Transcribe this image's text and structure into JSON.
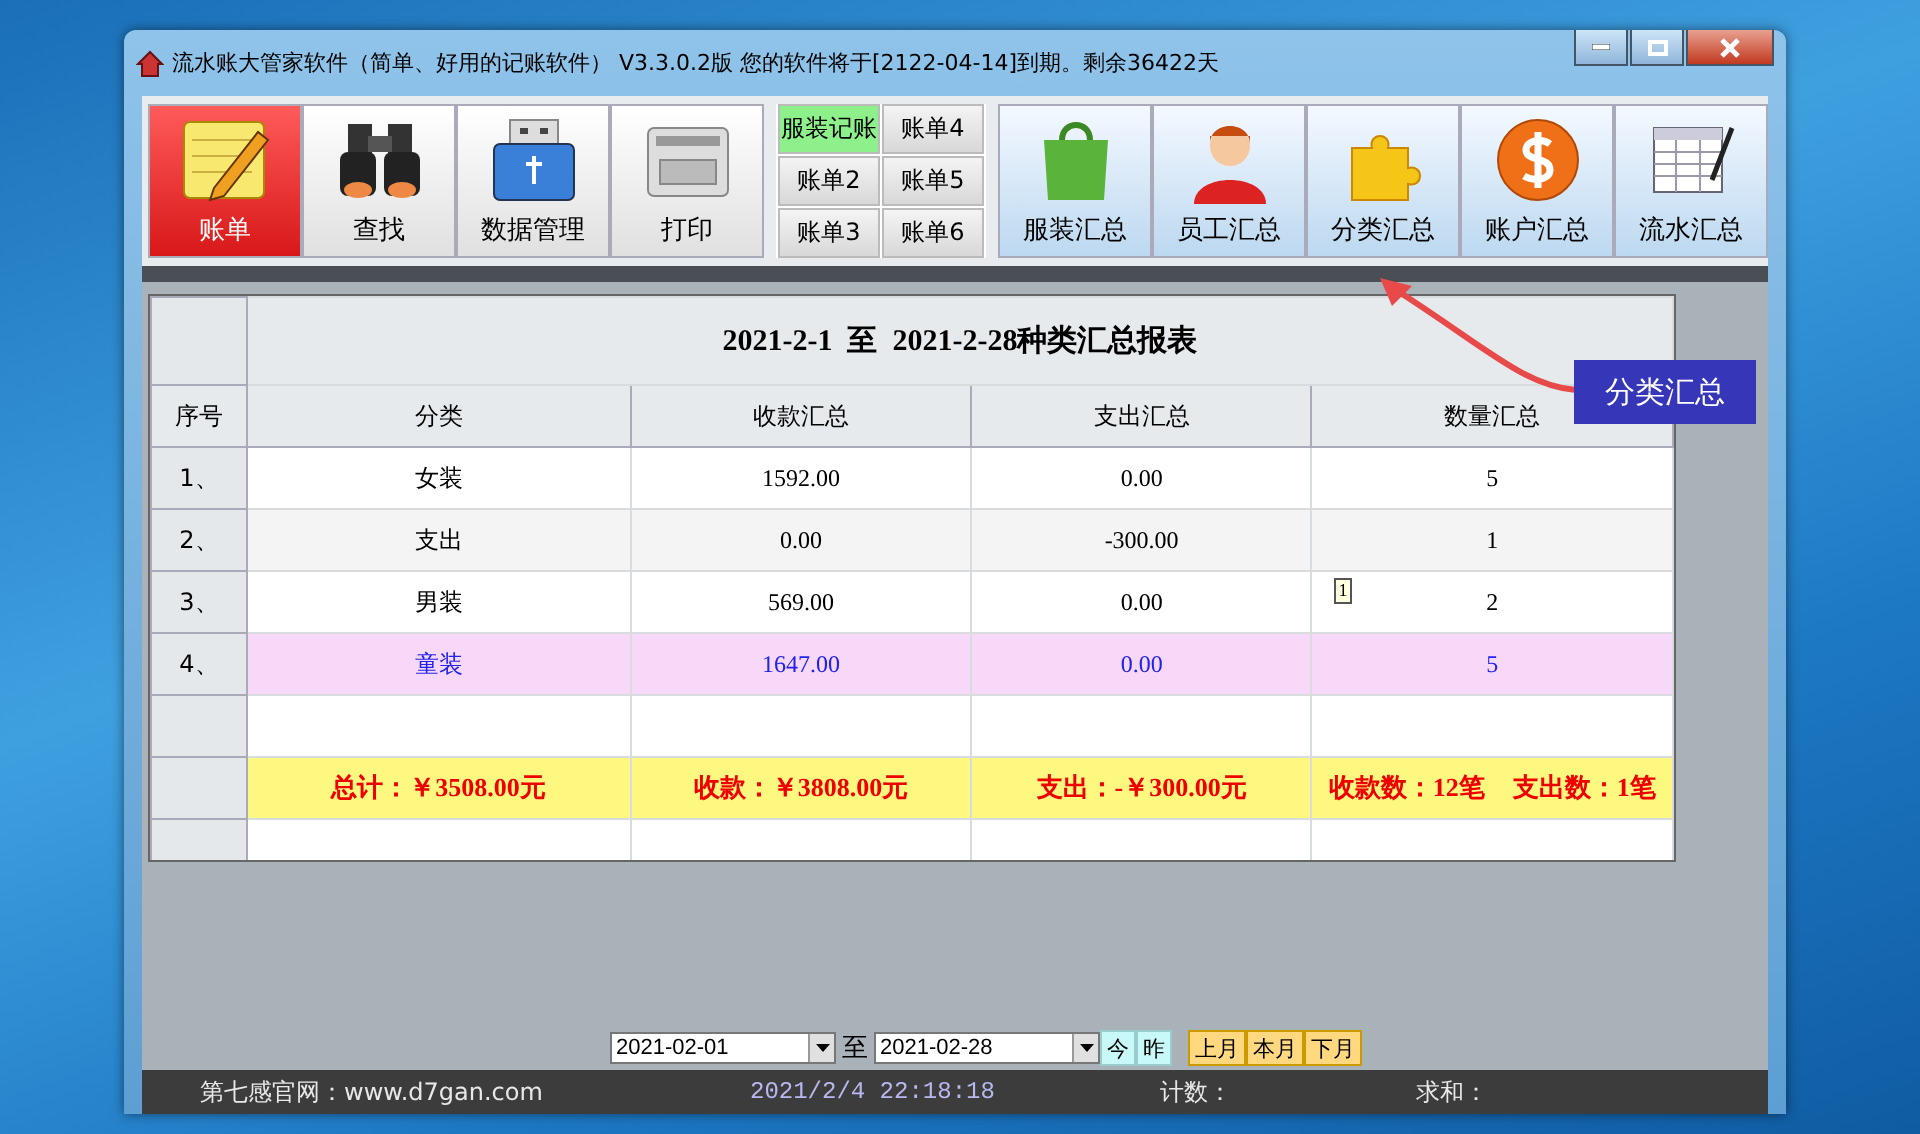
{
  "window": {
    "title": "流水账大管家软件（简单、好用的记账软件） V3.3.0.2版 您的软件将于[2122-04-14]到期。剩余36422天"
  },
  "toolbar": {
    "main_buttons": [
      {
        "label": "账单",
        "selected": true
      },
      {
        "label": "查找",
        "selected": false
      },
      {
        "label": "数据管理",
        "selected": false
      },
      {
        "label": "打印",
        "selected": false
      }
    ],
    "ledger_buttons": [
      {
        "label": "服装记账",
        "selected": true
      },
      {
        "label": "账单4",
        "selected": false
      },
      {
        "label": "账单2",
        "selected": false
      },
      {
        "label": "账单5",
        "selected": false
      },
      {
        "label": "账单3",
        "selected": false
      },
      {
        "label": "账单6",
        "selected": false
      }
    ],
    "summary_buttons": [
      {
        "label": "服装汇总"
      },
      {
        "label": "员工汇总"
      },
      {
        "label": "分类汇总"
      },
      {
        "label": "账户汇总"
      },
      {
        "label": "流水汇总"
      }
    ]
  },
  "report": {
    "title": "2021-2-1  至  2021-2-28种类汇总报表",
    "columns": [
      "序号",
      "分类",
      "收款汇总",
      "支出汇总",
      "数量汇总"
    ],
    "rows": [
      {
        "cells": [
          "1、",
          "女装",
          "1592.00",
          "0.00",
          "5"
        ],
        "highlighted": false
      },
      {
        "cells": [
          "2、",
          "支出",
          "0.00",
          "-300.00",
          "1"
        ],
        "highlighted": false
      },
      {
        "cells": [
          "3、",
          "男装",
          "569.00",
          "0.00",
          "2"
        ],
        "highlighted": false,
        "marker": "1"
      },
      {
        "cells": [
          "4、",
          "童装",
          "1647.00",
          "0.00",
          "5"
        ],
        "highlighted": true
      }
    ],
    "totals": [
      [
        "总计：￥3508.00元"
      ],
      [
        "收款：￥3808.00元"
      ],
      [
        "支出：-￥300.00元"
      ],
      [
        "收款数：12笔",
        "支出数：1笔"
      ]
    ]
  },
  "callout": {
    "label": "分类汇总"
  },
  "date_bar": {
    "from": "2021-02-01",
    "separator": "至",
    "to": "2021-02-28",
    "day_buttons": [
      "今",
      "昨"
    ],
    "month_buttons": [
      "上月",
      "本月",
      "下月"
    ]
  },
  "status_bar": {
    "site": "第七感官网：www.d7gan.com",
    "time": "2021/2/4 22:18:18",
    "count_label": "计数：",
    "sum_label": "求和："
  }
}
